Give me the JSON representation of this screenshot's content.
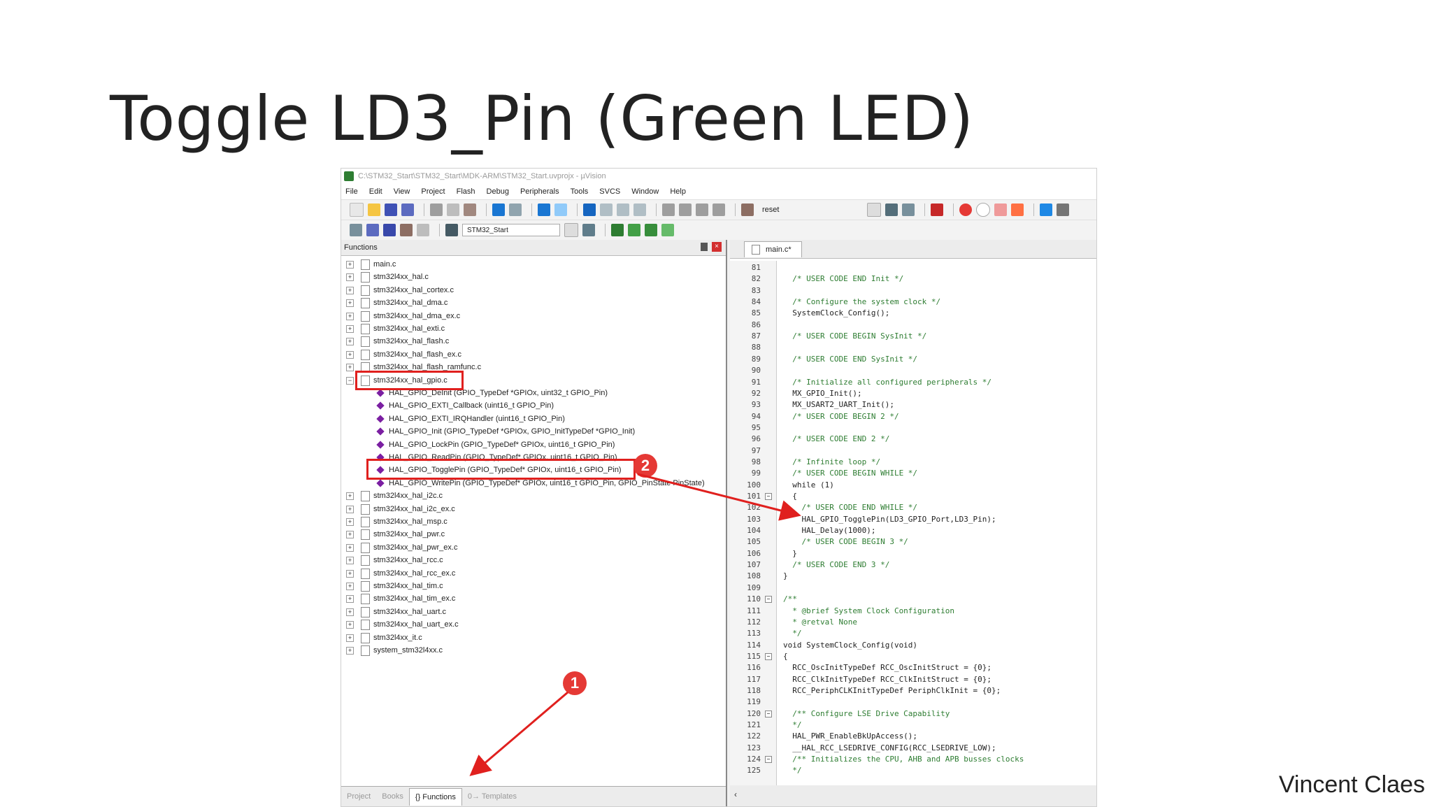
{
  "slide": {
    "title": "Toggle LD3_Pin (Green LED)",
    "author": "Vincent Claes"
  },
  "window": {
    "title": "C:\\STM32_Start\\STM32_Start\\MDK-ARM\\STM32_Start.uvprojx - µVision",
    "menu": [
      "File",
      "Edit",
      "View",
      "Project",
      "Flash",
      "Debug",
      "Peripherals",
      "Tools",
      "SVCS",
      "Window",
      "Help"
    ],
    "toolbar": {
      "search_text": "reset",
      "target": "STM32_Start"
    }
  },
  "functions_panel": {
    "header": "Functions",
    "close_glyph": "×",
    "expanded_glyph": "−",
    "collapsed_glyph": "+",
    "files_before": [
      "main.c",
      "stm32l4xx_hal.c",
      "stm32l4xx_hal_cortex.c",
      "stm32l4xx_hal_dma.c",
      "stm32l4xx_hal_dma_ex.c",
      "stm32l4xx_hal_exti.c",
      "stm32l4xx_hal_flash.c",
      "stm32l4xx_hal_flash_ex.c",
      "stm32l4xx_hal_flash_ramfunc.c"
    ],
    "expanded_file": "stm32l4xx_hal_gpio.c",
    "functions": [
      "HAL_GPIO_DeInit (GPIO_TypeDef *GPIOx, uint32_t GPIO_Pin)",
      "HAL_GPIO_EXTI_Callback (uint16_t GPIO_Pin)",
      "HAL_GPIO_EXTI_IRQHandler (uint16_t GPIO_Pin)",
      "HAL_GPIO_Init (GPIO_TypeDef *GPIOx, GPIO_InitTypeDef *GPIO_Init)",
      "HAL_GPIO_LockPin (GPIO_TypeDef* GPIOx, uint16_t GPIO_Pin)",
      "HAL_GPIO_ReadPin (GPIO_TypeDef* GPIOx, uint16_t GPIO_Pin)",
      "HAL_GPIO_TogglePin (GPIO_TypeDef* GPIOx, uint16_t GPIO_Pin)",
      "HAL_GPIO_WritePin (GPIO_TypeDef* GPIOx, uint16_t GPIO_Pin, GPIO_PinState PinState)"
    ],
    "files_after": [
      "stm32l4xx_hal_i2c.c",
      "stm32l4xx_hal_i2c_ex.c",
      "stm32l4xx_hal_msp.c",
      "stm32l4xx_hal_pwr.c",
      "stm32l4xx_hal_pwr_ex.c",
      "stm32l4xx_hal_rcc.c",
      "stm32l4xx_hal_rcc_ex.c",
      "stm32l4xx_hal_tim.c",
      "stm32l4xx_hal_tim_ex.c",
      "stm32l4xx_hal_uart.c",
      "stm32l4xx_hal_uart_ex.c",
      "stm32l4xx_it.c",
      "system_stm32l4xx.c"
    ],
    "bottom_tabs": [
      "Project",
      "Books",
      "{} Functions",
      "0→ Templates"
    ]
  },
  "editor": {
    "tab": "main.c*",
    "lines": [
      {
        "n": "81",
        "t": "",
        "fold": ""
      },
      {
        "n": "82",
        "t": "  /* USER CODE END Init */",
        "fold": ""
      },
      {
        "n": "83",
        "t": "",
        "fold": ""
      },
      {
        "n": "84",
        "t": "  /* Configure the system clock */",
        "fold": ""
      },
      {
        "n": "85",
        "t": "  SystemClock_Config();",
        "fold": ""
      },
      {
        "n": "86",
        "t": "",
        "fold": ""
      },
      {
        "n": "87",
        "t": "  /* USER CODE BEGIN SysInit */",
        "fold": ""
      },
      {
        "n": "88",
        "t": "",
        "fold": ""
      },
      {
        "n": "89",
        "t": "  /* USER CODE END SysInit */",
        "fold": ""
      },
      {
        "n": "90",
        "t": "",
        "fold": ""
      },
      {
        "n": "91",
        "t": "  /* Initialize all configured peripherals */",
        "fold": ""
      },
      {
        "n": "92",
        "t": "  MX_GPIO_Init();",
        "fold": ""
      },
      {
        "n": "93",
        "t": "  MX_USART2_UART_Init();",
        "fold": ""
      },
      {
        "n": "94",
        "t": "  /* USER CODE BEGIN 2 */",
        "fold": ""
      },
      {
        "n": "95",
        "t": "",
        "fold": ""
      },
      {
        "n": "96",
        "t": "  /* USER CODE END 2 */",
        "fold": ""
      },
      {
        "n": "97",
        "t": "",
        "fold": ""
      },
      {
        "n": "98",
        "t": "  /* Infinite loop */",
        "fold": ""
      },
      {
        "n": "99",
        "t": "  /* USER CODE BEGIN WHILE */",
        "fold": ""
      },
      {
        "n": "100",
        "t": "  while (1)",
        "fold": ""
      },
      {
        "n": "101",
        "t": "  {",
        "fold": "−"
      },
      {
        "n": "102",
        "t": "    /* USER CODE END WHILE */",
        "fold": ""
      },
      {
        "n": "103",
        "t": "    HAL_GPIO_TogglePin(LD3_GPIO_Port,LD3_Pin);",
        "fold": ""
      },
      {
        "n": "104",
        "t": "    HAL_Delay(1000);",
        "fold": ""
      },
      {
        "n": "105",
        "t": "    /* USER CODE BEGIN 3 */",
        "fold": ""
      },
      {
        "n": "106",
        "t": "  }",
        "fold": ""
      },
      {
        "n": "107",
        "t": "  /* USER CODE END 3 */",
        "fold": ""
      },
      {
        "n": "108",
        "t": "}",
        "fold": ""
      },
      {
        "n": "109",
        "t": "",
        "fold": ""
      },
      {
        "n": "110",
        "t": "/**",
        "fold": "−"
      },
      {
        "n": "111",
        "t": "  * @brief System Clock Configuration",
        "fold": ""
      },
      {
        "n": "112",
        "t": "  * @retval None",
        "fold": ""
      },
      {
        "n": "113",
        "t": "  */",
        "fold": ""
      },
      {
        "n": "114",
        "t": "void SystemClock_Config(void)",
        "fold": ""
      },
      {
        "n": "115",
        "t": "{",
        "fold": "−"
      },
      {
        "n": "116",
        "t": "  RCC_OscInitTypeDef RCC_OscInitStruct = {0};",
        "fold": ""
      },
      {
        "n": "117",
        "t": "  RCC_ClkInitTypeDef RCC_ClkInitStruct = {0};",
        "fold": ""
      },
      {
        "n": "118",
        "t": "  RCC_PeriphCLKInitTypeDef PeriphClkInit = {0};",
        "fold": ""
      },
      {
        "n": "119",
        "t": "",
        "fold": ""
      },
      {
        "n": "120",
        "t": "  /** Configure LSE Drive Capability",
        "fold": "−"
      },
      {
        "n": "121",
        "t": "  */",
        "fold": ""
      },
      {
        "n": "122",
        "t": "  HAL_PWR_EnableBkUpAccess();",
        "fold": ""
      },
      {
        "n": "123",
        "t": "  __HAL_RCC_LSEDRIVE_CONFIG(RCC_LSEDRIVE_LOW);",
        "fold": ""
      },
      {
        "n": "124",
        "t": "  /** Initializes the CPU, AHB and APB busses clocks",
        "fold": "−"
      },
      {
        "n": "125",
        "t": "  */",
        "fold": ""
      }
    ]
  },
  "annotations": {
    "badge_1": "1",
    "badge_2": "2",
    "color": "#e0201e"
  }
}
